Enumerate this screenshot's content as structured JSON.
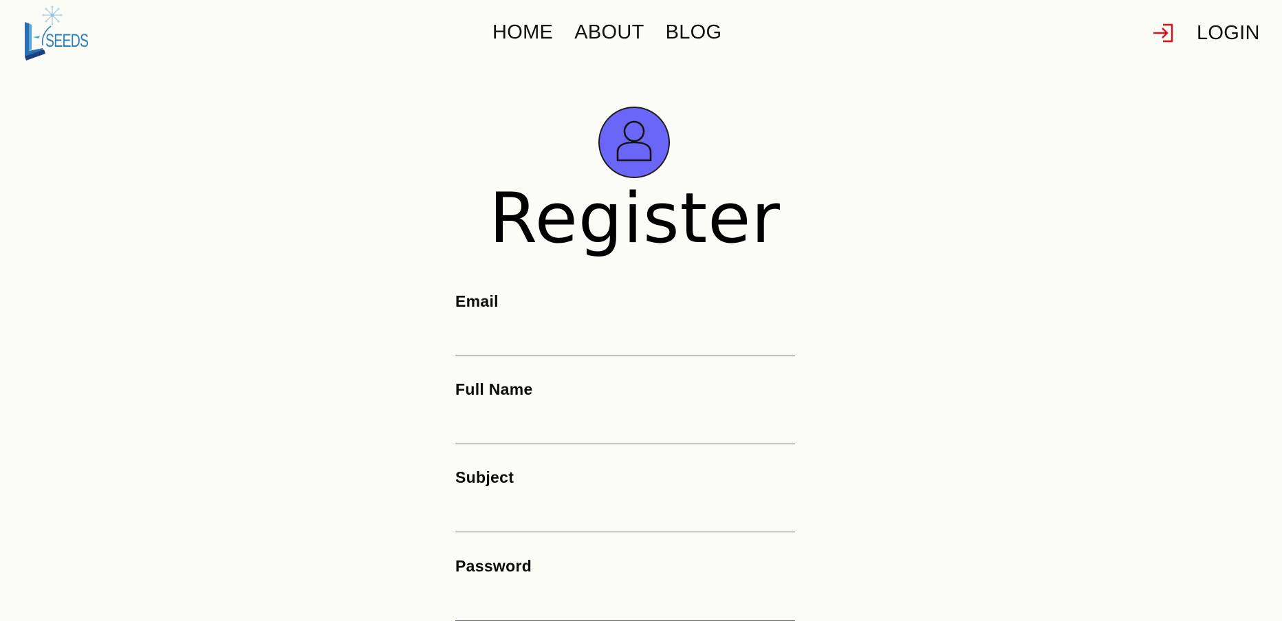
{
  "brand": {
    "logo_text": "SEEDS",
    "logo_icon": "seeds-logo-icon",
    "logo_color": "#2a7fc0"
  },
  "nav": {
    "items": [
      {
        "label": "HOME"
      },
      {
        "label": "ABOUT"
      },
      {
        "label": "BLOG"
      }
    ]
  },
  "login": {
    "label": "LOGIN",
    "icon": "login-arrow-icon",
    "icon_color": "#e0101a"
  },
  "form": {
    "avatar_icon": "user-avatar-icon",
    "avatar_color": "#6a66f8",
    "title": "Register",
    "fields": [
      {
        "label": "Email",
        "value": "",
        "placeholder": ""
      },
      {
        "label": "Full Name",
        "value": "",
        "placeholder": ""
      },
      {
        "label": "Subject",
        "value": "",
        "placeholder": ""
      },
      {
        "label": "Password",
        "value": "",
        "placeholder": ""
      }
    ]
  },
  "colors": {
    "background": "#fcfcf7",
    "text": "#111111",
    "underline": "#6f6f6f"
  }
}
